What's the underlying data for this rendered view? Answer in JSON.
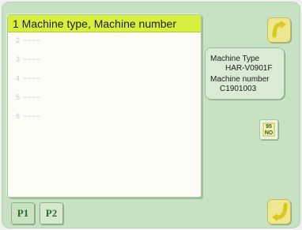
{
  "list": {
    "header": "1 Machine type, Machine number",
    "rows": [
      "2 ~~~~",
      "3 ~~~~",
      "4 ~~~~",
      "5 ~~~~",
      "6 ~~~~"
    ]
  },
  "info": {
    "type_label": "Machine Type",
    "type_value": "HAR-V0901F",
    "number_label": "Machine number",
    "number_value": "C1901003"
  },
  "small_button": {
    "line1": "95",
    "line2": "NO"
  },
  "pages": {
    "p1": "P1",
    "p2": "P2"
  },
  "colors": {
    "frame": "#c7e2c2",
    "header": "#d7f040",
    "arrow": "#e2d630",
    "page_text": "#2e6b2c"
  },
  "icons": {
    "top_button": "u-turn-up-arrow-icon",
    "bottom_button": "u-turn-down-arrow-icon",
    "small_button": "number-grid-icon"
  }
}
